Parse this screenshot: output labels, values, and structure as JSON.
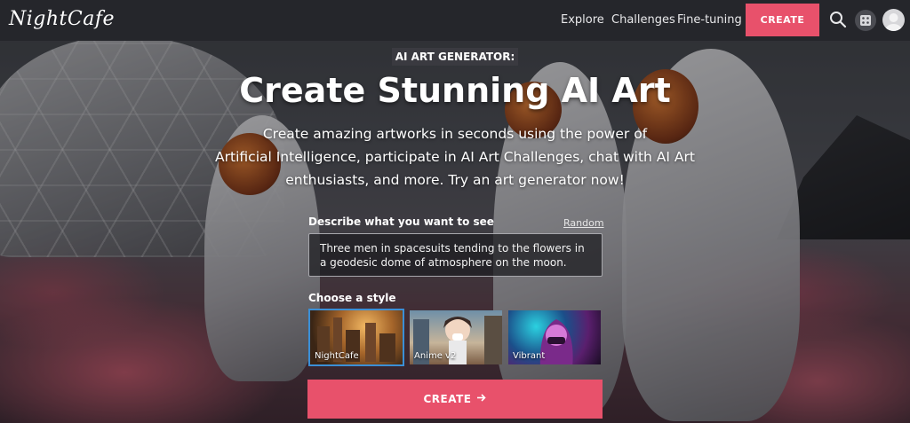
{
  "nav": {
    "logo": "NightCafe",
    "links": [
      "Explore",
      "Challenges",
      "Fine-tuning"
    ],
    "create_label": "CREATE"
  },
  "hero": {
    "badge": "AI ART GENERATOR:",
    "title": "Create Stunning AI Art",
    "subtitle_lines": [
      "Create amazing artworks in seconds using the power of",
      "Artificial Intelligence, participate in AI Art Challenges, chat with AI Art",
      "enthusiasts, and more. Try an art generator now!"
    ]
  },
  "prompt": {
    "label": "Describe what you want to see",
    "random_label": "Random",
    "value": "Three men in spacesuits tending to the flowers in a geodesic dome of atmosphere on the moon."
  },
  "styles": {
    "label": "Choose a style",
    "items": [
      {
        "name": "NightCafe",
        "selected": true
      },
      {
        "name": "Anime v2",
        "selected": false
      },
      {
        "name": "Vibrant",
        "selected": false
      }
    ]
  },
  "create_button": {
    "label": "CREATE",
    "icon": "arrow-right-icon"
  },
  "colors": {
    "accent": "#e8516b",
    "nav_bg": "#25262b",
    "selection": "#3b8fd6"
  }
}
